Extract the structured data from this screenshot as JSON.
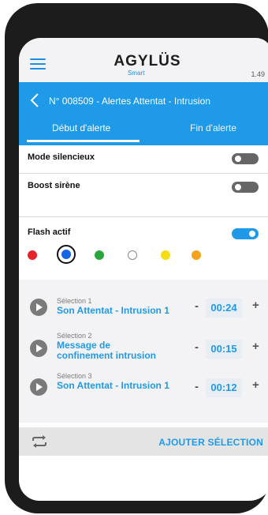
{
  "header": {
    "logo_text": "AGYLÜS",
    "logo_sub": "Smart",
    "version": "1.49"
  },
  "titlebar": {
    "title": "N° 008509 - Alertes Attentat - Intrusion",
    "tabs": [
      {
        "label": "Début d'alerte",
        "active": true
      },
      {
        "label": "Fin d'alerte",
        "active": false
      }
    ]
  },
  "settings": {
    "silent_mode": {
      "label": "Mode silencieux",
      "on": false
    },
    "boost_siren": {
      "label": "Boost sirène",
      "on": false
    },
    "flash_active": {
      "label": "Flash actif",
      "on": true
    }
  },
  "flash_colors": [
    {
      "name": "red",
      "hex": "#e8222a",
      "selected": false
    },
    {
      "name": "blue",
      "hex": "#1466e6",
      "selected": true
    },
    {
      "name": "green",
      "hex": "#2aa63a",
      "selected": false
    },
    {
      "name": "white",
      "hex": "#ffffff",
      "selected": false
    },
    {
      "name": "yellow",
      "hex": "#f6dc12",
      "selected": false
    },
    {
      "name": "orange",
      "hex": "#f5a21c",
      "selected": false
    }
  ],
  "selections": [
    {
      "caption": "Sélection 1",
      "name": "Son Attentat - Intrusion 1",
      "duration": "00:24"
    },
    {
      "caption": "Sélection 2",
      "name": "Message de confinement intrusion",
      "duration": "00:15"
    },
    {
      "caption": "Sélection 3",
      "name": "Son Attentat - Intrusion 1",
      "duration": "00:12"
    }
  ],
  "footer": {
    "add_label": "AJOUTER SÉLECTION",
    "repeat_icon": "repeat-icon"
  },
  "controls": {
    "minus": "-",
    "plus": "+"
  },
  "colors": {
    "accent": "#1f9ae8",
    "toggle_off": "#666666",
    "list_bg": "#f3f3f5"
  }
}
